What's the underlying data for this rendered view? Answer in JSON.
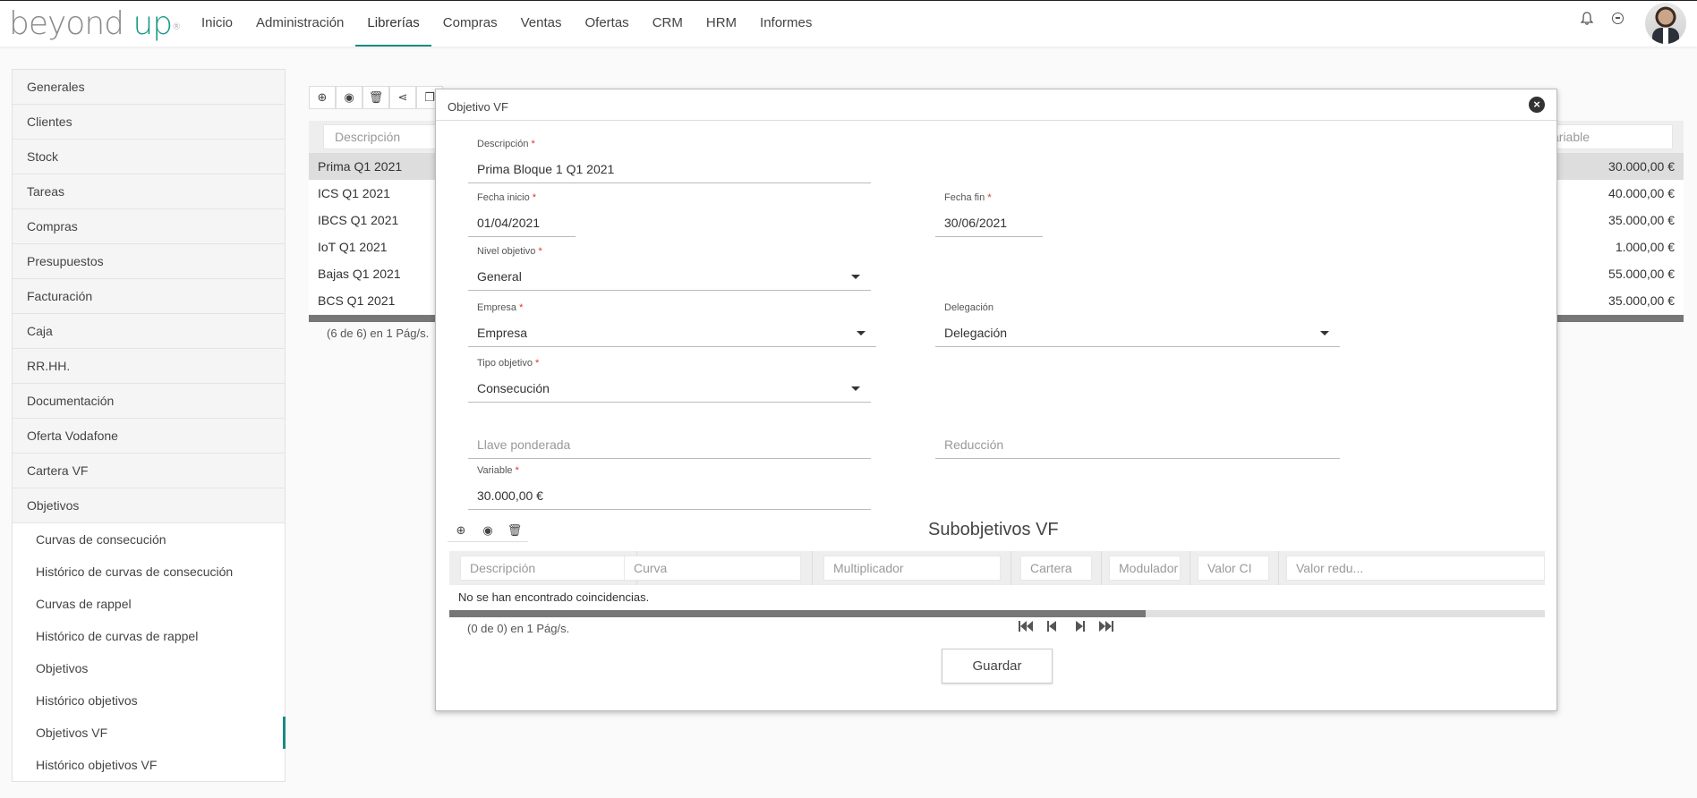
{
  "brand": {
    "part1": "beyond",
    "part2": "up",
    "reg": "®"
  },
  "nav": [
    "Inicio",
    "Administración",
    "Librerías",
    "Compras",
    "Ventas",
    "Ofertas",
    "CRM",
    "HRM",
    "Informes"
  ],
  "sidebar": {
    "items": [
      "Generales",
      "Clientes",
      "Stock",
      "Tareas",
      "Compras",
      "Presupuestos",
      "Facturación",
      "Caja",
      "RR.HH.",
      "Documentación",
      "Oferta Vodafone",
      "Cartera VF",
      "Objetivos"
    ],
    "subitems": [
      "Curvas de consecución",
      "Histórico de curvas de consecución",
      "Curvas de rappel",
      "Histórico de curvas de rappel",
      "Objetivos",
      "Histórico objetivos",
      "Objetivos VF",
      "Histórico objetivos VF"
    ]
  },
  "bg_table": {
    "desc_filter": "Descripción",
    "var_filter": "ariable",
    "rows": [
      {
        "desc": "Prima Q1 2021",
        "value": "30.000,00 €"
      },
      {
        "desc": "ICS Q1 2021",
        "value": "40.000,00 €"
      },
      {
        "desc": "IBCS Q1 2021",
        "value": "35.000,00 €"
      },
      {
        "desc": "IoT Q1 2021",
        "value": "1.000,00 €"
      },
      {
        "desc": "Bajas Q1 2021",
        "value": "55.000,00 €"
      },
      {
        "desc": "BCS Q1 2021",
        "value": "35.000,00 €"
      }
    ],
    "pager": "(6 de 6) en 1 Pág/s."
  },
  "modal": {
    "title": "Objetivo VF",
    "descripcion_label": "Descripción",
    "descripcion_value": "Prima Bloque 1 Q1 2021",
    "fecha_inicio_label": "Fecha inicio",
    "fecha_inicio_value": "01/04/2021",
    "fecha_fin_label": "Fecha fin",
    "fecha_fin_value": "30/06/2021",
    "nivel_label": "Nivel objetivo",
    "nivel_value": "General",
    "empresa_label": "Empresa",
    "empresa_value": "Empresa",
    "delegacion_label": "Delegación",
    "delegacion_value": "Delegación",
    "tipo_label": "Tipo objetivo",
    "tipo_value": "Consecución",
    "llave_placeholder": "Llave ponderada",
    "reduccion_placeholder": "Reducción",
    "variable_label": "Variable",
    "variable_value": "30.000,00 €",
    "req": "*",
    "sub_title": "Subobjetivos VF",
    "sub_columns": [
      "Descripción",
      "Curva",
      "Multiplicador",
      "Cartera",
      "Modulador",
      "Valor CI",
      "Valor redu..."
    ],
    "sub_empty": "No se han encontrado coincidencias.",
    "sub_pager": "(0 de 0) en 1 Pág/s.",
    "save": "Guardar"
  }
}
